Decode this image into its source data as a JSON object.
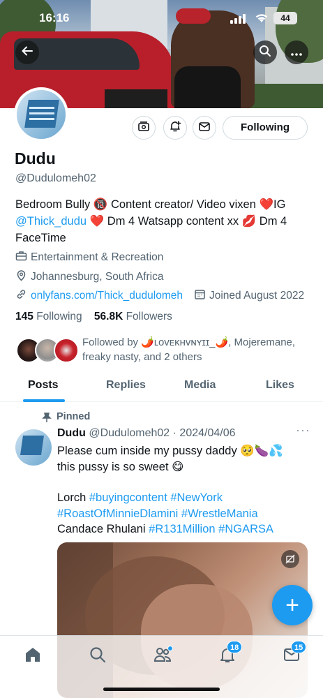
{
  "status_bar": {
    "time": "16:16",
    "battery": "44"
  },
  "header": {
    "back_icon": "arrow-left-icon",
    "search_icon": "search-icon",
    "more_icon": "more-horizontal-icon"
  },
  "profile": {
    "name": "Dudu",
    "handle": "@Dudulomeh02",
    "bio_part1": "Bedroom Bully 🔞 Content creator/ Video vixen ❤️IG ",
    "bio_link": "@Thick_dudu",
    "bio_part2": " ❤️ Dm 4 Watsapp content xx 💋 Dm 4 FaceTime",
    "category": "Entertainment & Recreation",
    "location": "Johannesburg, South Africa",
    "website": "onlyfans.com/Thick_dudulomeh",
    "joined": "Joined August 2022",
    "following_count": "145",
    "following_label": "Following",
    "followers_count": "56.8K",
    "followers_label": "Followers",
    "followed_by": "Followed by 🌶️ʟᴏᴠᴇᴋʜᴠɴʏɪɪ_🌶️, Mojeremane, freaky nasty, and 2 others"
  },
  "actions": {
    "following_button": "Following"
  },
  "tabs": [
    {
      "label": "Posts"
    },
    {
      "label": "Replies"
    },
    {
      "label": "Media"
    },
    {
      "label": "Likes"
    }
  ],
  "post": {
    "pinned_label": "Pinned",
    "author": "Dudu",
    "meta": "@Dudulomeh02 · 2024/04/06",
    "more": "···",
    "line1": "Please cum inside my pussy daddy 🥺🍆💦",
    "line2": "this pussy is so sweet 😋",
    "line3_plain": "Lorch ",
    "line3_tags": "#buyingcontent #NewYork",
    "line4_tags": "#RoastOfMinnieDlamini #WrestleMania",
    "line5_plain": "Candace Rhulani ",
    "line5_tags": "#R131Million #NGARSA"
  },
  "fab": {
    "label": "+"
  },
  "bottom_nav": {
    "notifications_badge": "18",
    "messages_badge": "15"
  },
  "colors": {
    "accent": "#1d9bf0",
    "text": "#0f1419",
    "secondary": "#536471"
  }
}
